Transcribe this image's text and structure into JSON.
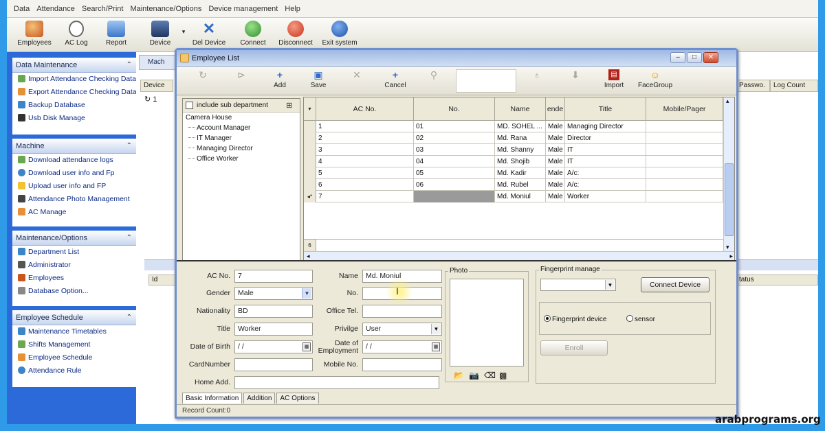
{
  "menu": [
    "Data",
    "Attendance",
    "Search/Print",
    "Maintenance/Options",
    "Device management",
    "Help"
  ],
  "toolbar": {
    "employees": "Employees",
    "ac_log": "AC Log",
    "report": "Report",
    "device": "Device",
    "del_device": "Del Device",
    "connect": "Connect",
    "disconnect": "Disconnect",
    "exit_system": "Exit system"
  },
  "sidebar": {
    "data_maintenance": {
      "title": "Data Maintenance",
      "items": [
        "Import Attendance Checking Data",
        "Export Attendance Checking Data",
        "Backup Database",
        "Usb Disk Manage"
      ]
    },
    "machine": {
      "title": "Machine",
      "items": [
        "Download attendance logs",
        "Download user info and Fp",
        "Upload user info and FP",
        "Attendance Photo Management",
        "AC Manage"
      ]
    },
    "maintenance": {
      "title": "Maintenance/Options",
      "items": [
        "Department List",
        "Administrator",
        "Employees",
        "Database Option..."
      ]
    },
    "schedule": {
      "title": "Employee Schedule",
      "items": [
        "Maintenance Timetables",
        "Shifts Management",
        "Employee Schedule",
        "Attendance Rule"
      ]
    }
  },
  "background": {
    "tab": "Mach",
    "col_device": "Device",
    "row_value": "1",
    "col_passwo": "Passwo.",
    "col_logcount": "Log Count",
    "col_id": "Id",
    "col_status": "tatus"
  },
  "window": {
    "title": "Employee List",
    "tools": {
      "add": "Add",
      "save": "Save",
      "cancel": "Cancel",
      "import": "Import",
      "facegroup": "FaceGroup"
    },
    "tree": {
      "include_sub": "include sub department",
      "root": "Camera House",
      "children": [
        "Account Manager",
        "IT Manager",
        "Managing Director",
        "Office Worker"
      ]
    },
    "grid": {
      "columns": [
        "AC No.",
        "No.",
        "Name",
        "ende",
        "Title",
        "Mobile/Pager"
      ],
      "rows": [
        [
          "1",
          "01",
          "MD. SOHEL ...",
          "Male",
          "Managing Director"
        ],
        [
          "2",
          "02",
          "Md. Rana",
          "Male",
          "Director"
        ],
        [
          "3",
          "03",
          "Md. Shanny",
          "Male",
          "IT"
        ],
        [
          "4",
          "04",
          "Md. Shojib",
          "Male",
          "IT"
        ],
        [
          "5",
          "05",
          "Md. Kadir",
          "Male",
          "A/c:"
        ],
        [
          "6",
          "06",
          "Md. Rubel",
          "Male",
          "A/c:"
        ],
        [
          "7",
          "",
          "Md. Moniul",
          "Male",
          "Worker"
        ]
      ],
      "summary_count": "6"
    },
    "form": {
      "labels": {
        "ac_no": "AC No.",
        "gender": "Gender",
        "nationality": "Nationality",
        "title": "Title",
        "dob": "Date of Birth",
        "card": "CardNumber",
        "home": "Home Add.",
        "name": "Name",
        "no": "No.",
        "office_tel": "Office Tel.",
        "privilege": "Privilge",
        "doe": "Date of Employment",
        "mobile": "Mobile No.",
        "photo": "Photo",
        "fingerprint": "Fingerprint manage"
      },
      "values": {
        "ac_no": "7",
        "gender": "Male",
        "nationality": "BD",
        "title": "Worker",
        "dob": "/  /",
        "name": "Md. Moniul",
        "privilege": "User",
        "doe": "/  /"
      },
      "connect_device": "Connect Device",
      "fp_device": "Fingerprint device",
      "sensor": "sensor",
      "enroll": "Enroll"
    },
    "tabs": [
      "Basic Information",
      "Addition",
      "AC Options"
    ],
    "status": "Record Count:0"
  },
  "watermark": "arabprograms.org"
}
